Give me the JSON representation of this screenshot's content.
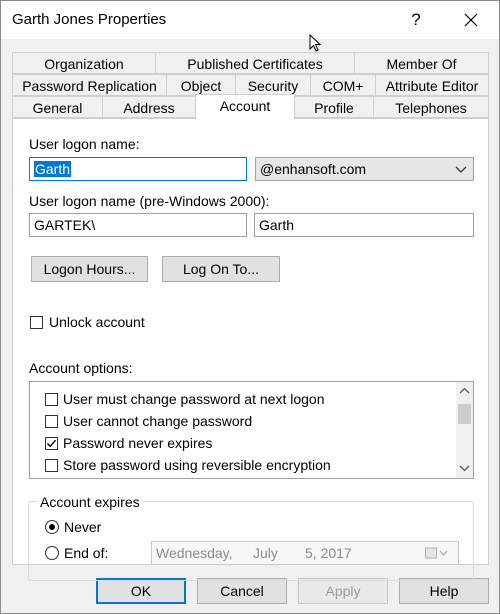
{
  "window": {
    "title": "Garth Jones Properties",
    "help_label": "?"
  },
  "tabs": {
    "row1": [
      "Organization",
      "Published Certificates",
      "Member Of"
    ],
    "row2": [
      "Password Replication",
      "Object",
      "Security",
      "COM+",
      "Attribute Editor"
    ],
    "row3": [
      "General",
      "Address",
      "Account",
      "Profile",
      "Telephones"
    ],
    "active": "Account"
  },
  "account": {
    "logon_label": "User logon name:",
    "logon_value": "Garth",
    "domain_value": "@enhansoft.com",
    "pre2000_label": "User logon name (pre-Windows 2000):",
    "pre2000_domain": "GARTEK\\",
    "pre2000_name": "Garth",
    "logon_hours_btn": "Logon Hours...",
    "logon_to_btn": "Log On To...",
    "unlock_label": "Unlock account",
    "unlock_checked": false,
    "options_label": "Account options:",
    "options": [
      {
        "label": "User must change password at next logon",
        "checked": false
      },
      {
        "label": "User cannot change password",
        "checked": false
      },
      {
        "label": "Password never expires",
        "checked": true
      },
      {
        "label": "Store password using reversible encryption",
        "checked": false
      }
    ],
    "expires_label": "Account expires",
    "never_label": "Never",
    "end_of_label": "End of:",
    "expires_selected": "Never",
    "date": {
      "weekday": "Wednesday,",
      "month": "July",
      "day": "5, 2017"
    }
  },
  "buttons": {
    "ok": "OK",
    "cancel": "Cancel",
    "apply": "Apply",
    "help": "Help"
  },
  "colors": {
    "accent": "#0078d7",
    "panel": "#ffffff",
    "chrome": "#f0f0f0"
  }
}
